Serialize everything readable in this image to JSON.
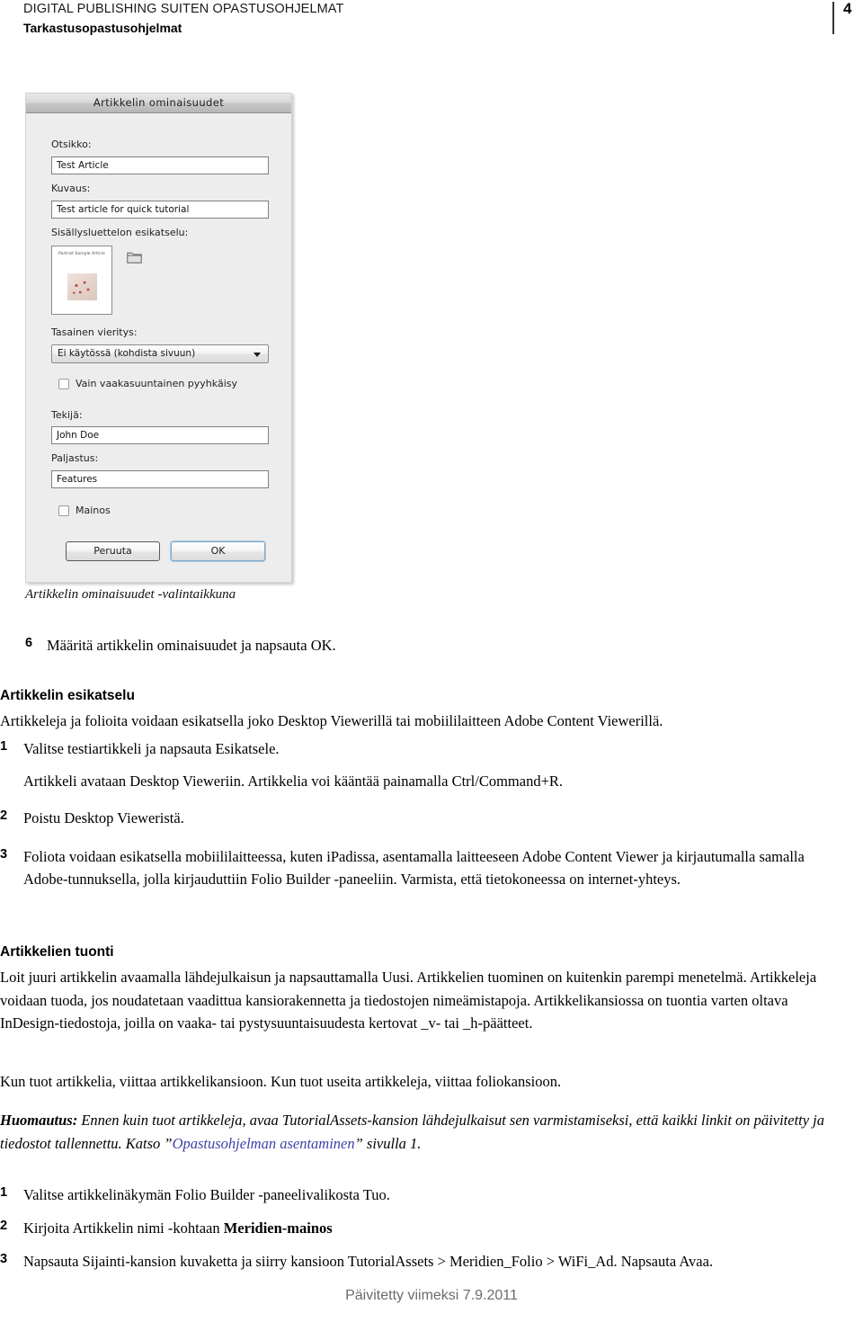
{
  "header": {
    "line1": "DIGITAL PUBLISHING SUITEN OPASTUSOHJELMAT",
    "line2": "Tarkastusopastusohjelmat",
    "page_number": "4"
  },
  "dialog": {
    "title": "Artikkelin ominaisuudet",
    "fields": {
      "title_label": "Otsikko:",
      "title_value": "Test Article",
      "description_label": "Kuvaus:",
      "description_value": "Test article for quick tutorial",
      "toc_preview_label": "Sisällysluettelon esikatselu:",
      "toc_preview_thumb_caption": "Portrait Sample Article",
      "smooth_scroll_label": "Tasainen vieritys:",
      "smooth_scroll_value": "Ei käytössä (kohdista sivuun)",
      "horizontal_swipe_label": "Vain vaakasuuntainen pyyhkäisy",
      "author_label": "Tekijä:",
      "author_value": "John Doe",
      "kicker_label": "Paljastus:",
      "kicker_value": "Features",
      "ad_label": "Mainos"
    },
    "buttons": {
      "cancel": "Peruuta",
      "ok": "OK"
    }
  },
  "figure_caption": "Artikkelin ominaisuudet -valintaikkuna",
  "content": {
    "step6_num": "6",
    "step6_text": "Määritä artikkelin ominaisuudet ja napsauta OK.",
    "heading_preview": "Artikkelin esikatselu",
    "preview_intro": "Artikkeleja ja folioita voidaan esikatsella joko Desktop Viewerillä tai mobiililaitteen Adobe Content Viewerillä.",
    "p1_num": "1",
    "p1_text": "Valitse testiartikkeli ja napsauta Esikatsele.",
    "p1_sub": "Artikkeli avataan Desktop Vieweriin. Artikkelia voi kääntää painamalla Ctrl/Command+R.",
    "p2_num": "2",
    "p2_text": "Poistu Desktop Vieweristä.",
    "p3_num": "3",
    "p3_text": "Foliota voidaan esikatsella mobiililaitteessa, kuten iPadissa, asentamalla laitteeseen Adobe Content Viewer ja kirjautumalla samalla Adobe-tunnuksella, jolla kirjauduttiin Folio Builder -paneeliin. Varmista, että tietokoneessa on internet-yhteys.",
    "heading_import": "Artikkelien tuonti",
    "import_para": "Loit juuri artikkelin avaamalla lähdejulkaisun ja napsauttamalla Uusi. Artikkelien tuominen on kuitenkin parempi menetelmä. Artikkeleja voidaan tuoda, jos noudatetaan vaadittua kansiorakennetta ja tiedostojen nimeämistapoja. Artikkelikansiossa on tuontia varten oltava InDesign-tiedostoja, joilla on vaaka- tai pystysuuntaisuudesta kertovat _v- tai _h-päätteet.",
    "import_para2": "Kun tuot artikkelia, viittaa artikkelikansioon. Kun tuot useita artikkeleja, viittaa foliokansioon.",
    "note_label": "Huomautus:",
    "note_text_1": " Ennen kuin tuot artikkeleja, avaa TutorialAssets-kansion lähdejulkaisut sen varmistamiseksi, että kaikki linkit on päivitetty ja tiedostot tallennettu. Katso ”",
    "note_link": "Opastusohjelman asentaminen",
    "note_text_2": "” sivulla 1.",
    "i1_num": "1",
    "i1_text": "Valitse artikkelinäkymän Folio Builder -paneelivalikosta Tuo.",
    "i2_num": "2",
    "i2_text_a": "Kirjoita Artikkelin nimi -kohtaan ",
    "i2_text_b": "Meridien-mainos",
    "i3_num": "3",
    "i3_text": "Napsauta Sijainti-kansion kuvaketta ja siirry kansioon TutorialAssets > Meridien_Folio > WiFi_Ad. Napsauta Avaa."
  },
  "footer": {
    "text": "Päivitetty viimeksi 7.9.2011"
  }
}
